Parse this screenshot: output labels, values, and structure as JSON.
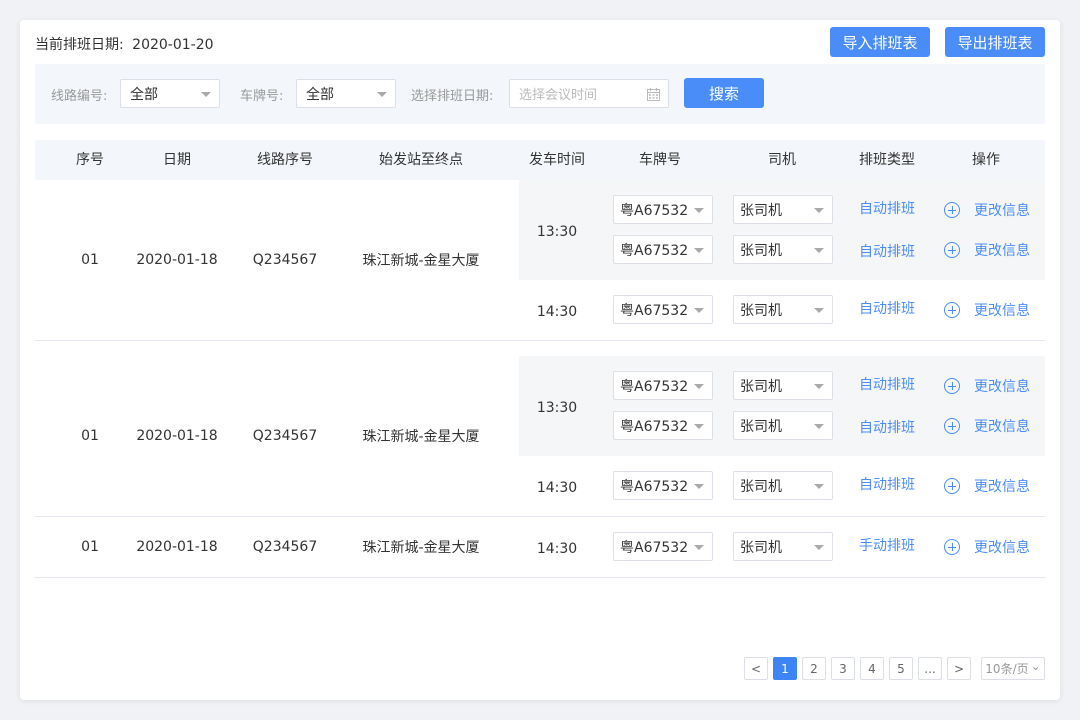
{
  "header": {
    "current_date_label": "当前排班日期:",
    "current_date_value": "2020-01-20",
    "import_button": "导入排班表",
    "export_button": "导出排班表"
  },
  "filters": {
    "route_label": "线路编号:",
    "route_value": "全部",
    "plate_label": "车牌号:",
    "plate_value": "全部",
    "date_label": "选择排班日期:",
    "date_placeholder": "选择会议时间",
    "search_button": "搜索"
  },
  "table": {
    "columns": [
      "序号",
      "日期",
      "线路序号",
      "始发站至终点",
      "发车时间",
      "车牌号",
      "司机",
      "排班类型",
      "操作"
    ],
    "groups": [
      {
        "index": "01",
        "date": "2020-01-18",
        "route": "Q234567",
        "stations": "珠江新城-金星大厦",
        "departures": [
          {
            "time": "13:30",
            "shaded": true,
            "entries": [
              {
                "plate": "粤A67532",
                "driver": "张司机",
                "type": "自动排班",
                "action": "更改信息"
              },
              {
                "plate": "粤A67532",
                "driver": "张司机",
                "type": "自动排班",
                "action": "更改信息"
              }
            ]
          },
          {
            "time": "14:30",
            "shaded": false,
            "entries": [
              {
                "plate": "粤A67532",
                "driver": "张司机",
                "type": "自动排班",
                "action": "更改信息"
              }
            ]
          }
        ]
      },
      {
        "index": "01",
        "date": "2020-01-18",
        "route": "Q234567",
        "stations": "珠江新城-金星大厦",
        "departures": [
          {
            "time": "13:30",
            "shaded": true,
            "entries": [
              {
                "plate": "粤A67532",
                "driver": "张司机",
                "type": "自动排班",
                "action": "更改信息"
              },
              {
                "plate": "粤A67532",
                "driver": "张司机",
                "type": "自动排班",
                "action": "更改信息"
              }
            ]
          },
          {
            "time": "14:30",
            "shaded": false,
            "entries": [
              {
                "plate": "粤A67532",
                "driver": "张司机",
                "type": "自动排班",
                "action": "更改信息"
              }
            ]
          }
        ]
      },
      {
        "index": "01",
        "date": "2020-01-18",
        "route": "Q234567",
        "stations": "珠江新城-金星大厦",
        "departures": [
          {
            "time": "14:30",
            "shaded": false,
            "entries": [
              {
                "plate": "粤A67532",
                "driver": "张司机",
                "type": "手动排班",
                "action": "更改信息"
              }
            ]
          }
        ]
      }
    ]
  },
  "pagination": {
    "prev": "<",
    "pages": [
      "1",
      "2",
      "3",
      "4",
      "5"
    ],
    "ellipsis": "...",
    "next": ">",
    "page_size": "10条/页",
    "active_page": "1"
  },
  "colors": {
    "accent": "#4a8df8",
    "panel": "#f3f6fa"
  }
}
